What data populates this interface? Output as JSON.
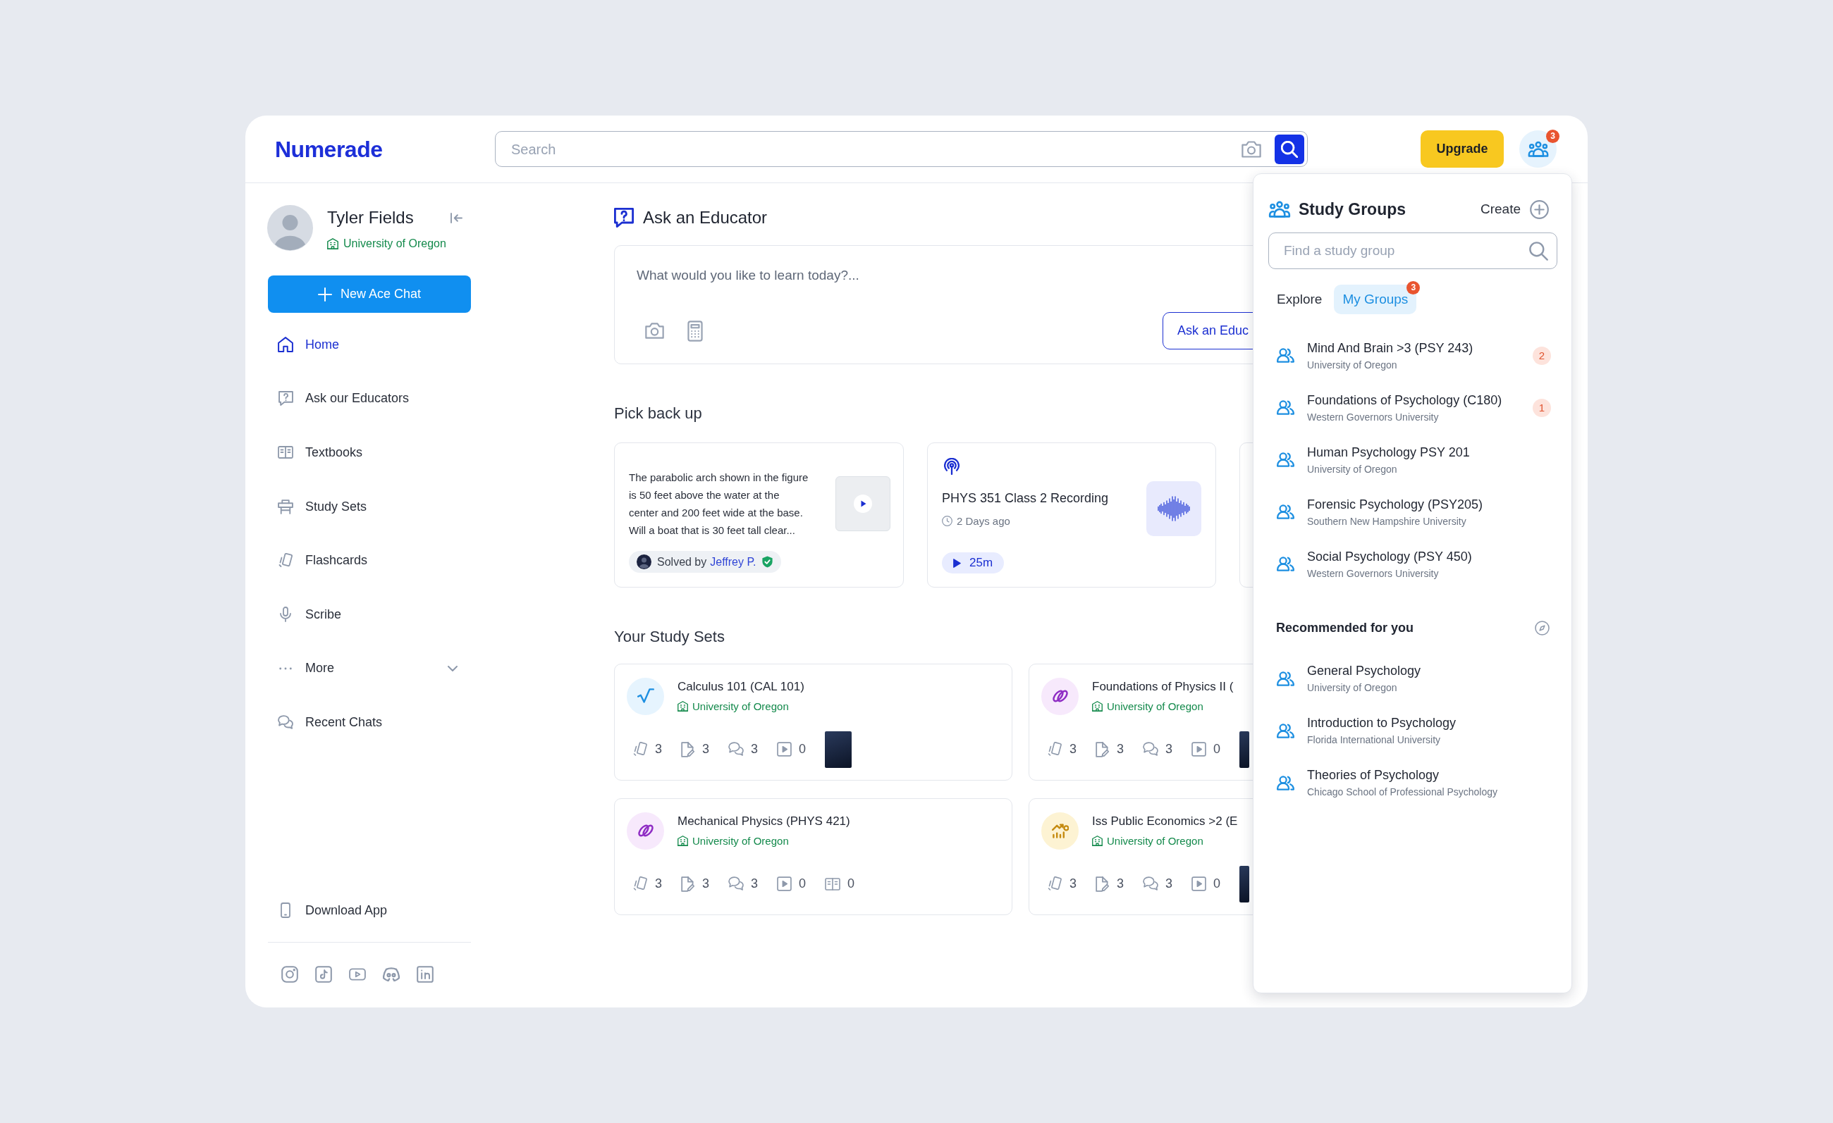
{
  "header": {
    "logo": "Numerade",
    "search": {
      "placeholder": "Search"
    },
    "upgrade": "Upgrade",
    "groups_badge": "3"
  },
  "sidebar": {
    "user": {
      "name": "Tyler Fields",
      "school": "University of Oregon"
    },
    "new_chat": "New Ace Chat",
    "items": [
      {
        "kind": "home",
        "label": "Home",
        "selected": true
      },
      {
        "kind": "educators",
        "label": "Ask our Educators",
        "selected": false
      },
      {
        "kind": "textbooks",
        "label": "Textbooks",
        "selected": false
      },
      {
        "kind": "study_sets",
        "label": "Study Sets",
        "selected": false
      },
      {
        "kind": "flashcards",
        "label": "Flashcards",
        "selected": false
      },
      {
        "kind": "scribe",
        "label": "Scribe",
        "selected": false
      },
      {
        "kind": "more",
        "label": "More",
        "selected": false,
        "expanded": false
      },
      {
        "kind": "chats",
        "label": "Recent Chats",
        "selected": false
      }
    ],
    "download": "Download App"
  },
  "ask_educator": {
    "title": "Ask an Educator",
    "placeholder": "What would you like to learn today?...",
    "button": "Ask an Educ"
  },
  "pick_back_up": {
    "title": "Pick back up",
    "items": [
      {
        "kind": "solution",
        "text": "The parabolic arch shown in the figure is 50 feet above the water at the center and 200 feet wide at the base. Will a boat that is 30 feet tall clear...",
        "solved_by": "Solved by",
        "tutor": "Jeffrey P."
      },
      {
        "kind": "recording",
        "title": "PHYS 351 Class 2 Recording",
        "time": "2 Days ago",
        "duration": "25m"
      },
      {
        "kind": "partial"
      }
    ]
  },
  "study_sets": {
    "title": "Your Study Sets",
    "items": [
      {
        "kind": "math",
        "title": "Calculus 101 (CAL 101)",
        "school": "University of Oregon",
        "stats": [
          {
            "kind": "flashcards",
            "count": "3"
          },
          {
            "kind": "notes",
            "count": "3"
          },
          {
            "kind": "chats",
            "count": "3"
          },
          {
            "kind": "videos",
            "count": "0"
          }
        ],
        "cover": true
      },
      {
        "kind": "physics",
        "title": "Foundations of Physics II (",
        "school": "University of Oregon",
        "stats": [
          {
            "kind": "flashcards",
            "count": "3"
          },
          {
            "kind": "notes",
            "count": "3"
          },
          {
            "kind": "chats",
            "count": "3"
          },
          {
            "kind": "videos",
            "count": "0"
          }
        ],
        "cover": true
      },
      {
        "kind": "physics",
        "title": "Mechanical Physics (PHYS 421)",
        "school": "University of Oregon",
        "stats": [
          {
            "kind": "flashcards",
            "count": "3"
          },
          {
            "kind": "notes",
            "count": "3"
          },
          {
            "kind": "chats",
            "count": "3"
          },
          {
            "kind": "videos",
            "count": "0"
          },
          {
            "kind": "textbooks",
            "count": "0"
          }
        ],
        "cover": false
      },
      {
        "kind": "economics",
        "title": "Iss Public Economics >2 (E",
        "school": "University of Oregon",
        "stats": [
          {
            "kind": "flashcards",
            "count": "3"
          },
          {
            "kind": "notes",
            "count": "3"
          },
          {
            "kind": "chats",
            "count": "3"
          },
          {
            "kind": "videos",
            "count": "0"
          }
        ],
        "cover": true
      }
    ]
  },
  "study_groups": {
    "title": "Study Groups",
    "create": "Create",
    "search": {
      "placeholder": "Find a study group"
    },
    "tabs": [
      {
        "label": "Explore",
        "selected": false
      },
      {
        "label": "My Groups",
        "selected": true,
        "badge": "3"
      }
    ],
    "groups": [
      {
        "name": "Mind And Brain >3 (PSY 243)",
        "school": "University of Oregon",
        "unread": "2"
      },
      {
        "name": "Foundations of Psychology (C180)",
        "school": "Western Governors University",
        "unread": "1"
      },
      {
        "name": "Human Psychology PSY 201",
        "school": "University of Oregon"
      },
      {
        "name": "Forensic Psychology (PSY205)",
        "school": "Southern New Hampshire University"
      },
      {
        "name": "Social Psychology (PSY 450)",
        "school": "Western Governors University"
      }
    ],
    "recommended": {
      "title": "Recommended for you",
      "groups": [
        {
          "name": "General Psychology",
          "school": "University of Oregon"
        },
        {
          "name": "Introduction to Psychology",
          "school": "Florida International University"
        },
        {
          "name": "Theories of Psychology",
          "school": "Chicago School of Professional Psychology"
        }
      ]
    }
  }
}
